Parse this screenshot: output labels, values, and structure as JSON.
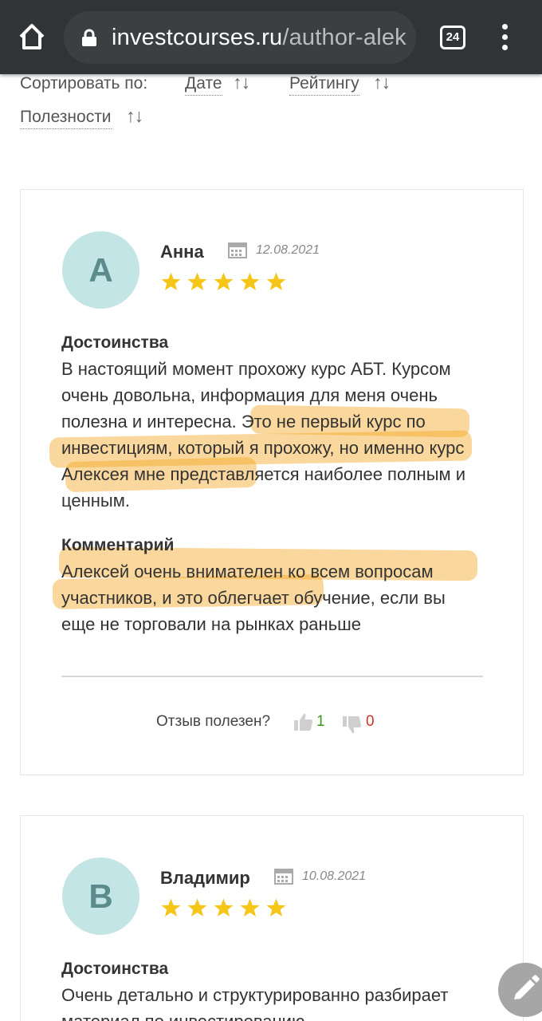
{
  "browser": {
    "url_host": "investcourses.ru",
    "url_path": "/author-alek",
    "tab_count": "24"
  },
  "sort": {
    "label": "Сортировать по:",
    "options": [
      "Дате",
      "Рейтингу",
      "Полезности"
    ],
    "arrows": "↑↓"
  },
  "reviews": [
    {
      "initial": "А",
      "author": "Анна",
      "date": "12.08.2021",
      "rating": 5,
      "pros_heading": "Достоинства",
      "pros_text": "В настоящий момент прохожу курс АБТ. Курсом очень довольна, информация для меня очень полезна и интересна. Это не первый курс по инвестициям, который я прохожу, но именно курс Алексея мне представляется наиболее полным и ценным.",
      "comment_heading": "Комментарий",
      "comment_text": "Алексей очень внимателен ко всем вопросам участников, и это облегчает обучение, если вы еще не торговали на рынках раньше",
      "useful_question": "Отзыв полезен?",
      "likes": "1",
      "dislikes": "0"
    },
    {
      "initial": "В",
      "author": "Владимир",
      "date": "10.08.2021",
      "rating": 5,
      "pros_heading": "Достоинства",
      "pros_text": "Очень детально и структурированно разбирает материал по инвестированию"
    }
  ],
  "colors": {
    "chrome": "#303437",
    "avatar_bg": "#c4e5e6",
    "star": "#f5c518",
    "highlight": "#f5a623",
    "likes": "#3a9a1f",
    "dislikes": "#d0312d"
  }
}
